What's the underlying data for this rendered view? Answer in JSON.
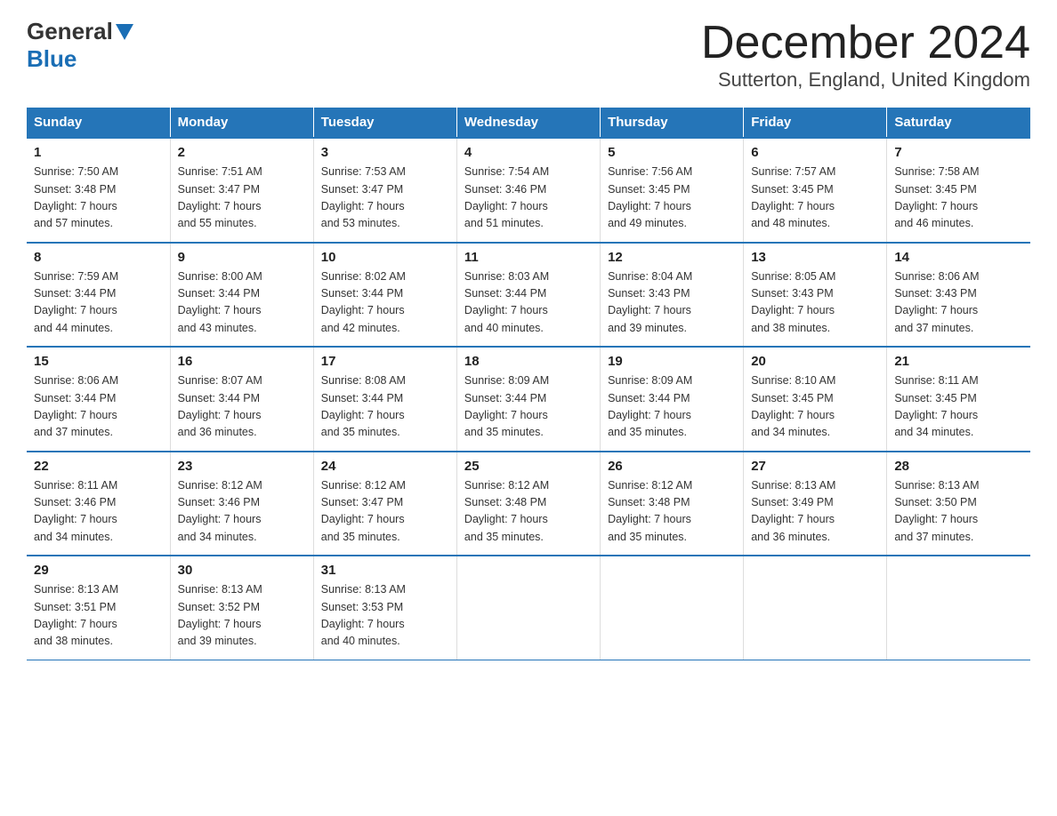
{
  "header": {
    "logo_general": "General",
    "logo_blue": "Blue",
    "month_title": "December 2024",
    "location": "Sutterton, England, United Kingdom"
  },
  "weekdays": [
    "Sunday",
    "Monday",
    "Tuesday",
    "Wednesday",
    "Thursday",
    "Friday",
    "Saturday"
  ],
  "weeks": [
    [
      {
        "day": "1",
        "sunrise": "7:50 AM",
        "sunset": "3:48 PM",
        "daylight": "7 hours and 57 minutes."
      },
      {
        "day": "2",
        "sunrise": "7:51 AM",
        "sunset": "3:47 PM",
        "daylight": "7 hours and 55 minutes."
      },
      {
        "day": "3",
        "sunrise": "7:53 AM",
        "sunset": "3:47 PM",
        "daylight": "7 hours and 53 minutes."
      },
      {
        "day": "4",
        "sunrise": "7:54 AM",
        "sunset": "3:46 PM",
        "daylight": "7 hours and 51 minutes."
      },
      {
        "day": "5",
        "sunrise": "7:56 AM",
        "sunset": "3:45 PM",
        "daylight": "7 hours and 49 minutes."
      },
      {
        "day": "6",
        "sunrise": "7:57 AM",
        "sunset": "3:45 PM",
        "daylight": "7 hours and 48 minutes."
      },
      {
        "day": "7",
        "sunrise": "7:58 AM",
        "sunset": "3:45 PM",
        "daylight": "7 hours and 46 minutes."
      }
    ],
    [
      {
        "day": "8",
        "sunrise": "7:59 AM",
        "sunset": "3:44 PM",
        "daylight": "7 hours and 44 minutes."
      },
      {
        "day": "9",
        "sunrise": "8:00 AM",
        "sunset": "3:44 PM",
        "daylight": "7 hours and 43 minutes."
      },
      {
        "day": "10",
        "sunrise": "8:02 AM",
        "sunset": "3:44 PM",
        "daylight": "7 hours and 42 minutes."
      },
      {
        "day": "11",
        "sunrise": "8:03 AM",
        "sunset": "3:44 PM",
        "daylight": "7 hours and 40 minutes."
      },
      {
        "day": "12",
        "sunrise": "8:04 AM",
        "sunset": "3:43 PM",
        "daylight": "7 hours and 39 minutes."
      },
      {
        "day": "13",
        "sunrise": "8:05 AM",
        "sunset": "3:43 PM",
        "daylight": "7 hours and 38 minutes."
      },
      {
        "day": "14",
        "sunrise": "8:06 AM",
        "sunset": "3:43 PM",
        "daylight": "7 hours and 37 minutes."
      }
    ],
    [
      {
        "day": "15",
        "sunrise": "8:06 AM",
        "sunset": "3:44 PM",
        "daylight": "7 hours and 37 minutes."
      },
      {
        "day": "16",
        "sunrise": "8:07 AM",
        "sunset": "3:44 PM",
        "daylight": "7 hours and 36 minutes."
      },
      {
        "day": "17",
        "sunrise": "8:08 AM",
        "sunset": "3:44 PM",
        "daylight": "7 hours and 35 minutes."
      },
      {
        "day": "18",
        "sunrise": "8:09 AM",
        "sunset": "3:44 PM",
        "daylight": "7 hours and 35 minutes."
      },
      {
        "day": "19",
        "sunrise": "8:09 AM",
        "sunset": "3:44 PM",
        "daylight": "7 hours and 35 minutes."
      },
      {
        "day": "20",
        "sunrise": "8:10 AM",
        "sunset": "3:45 PM",
        "daylight": "7 hours and 34 minutes."
      },
      {
        "day": "21",
        "sunrise": "8:11 AM",
        "sunset": "3:45 PM",
        "daylight": "7 hours and 34 minutes."
      }
    ],
    [
      {
        "day": "22",
        "sunrise": "8:11 AM",
        "sunset": "3:46 PM",
        "daylight": "7 hours and 34 minutes."
      },
      {
        "day": "23",
        "sunrise": "8:12 AM",
        "sunset": "3:46 PM",
        "daylight": "7 hours and 34 minutes."
      },
      {
        "day": "24",
        "sunrise": "8:12 AM",
        "sunset": "3:47 PM",
        "daylight": "7 hours and 35 minutes."
      },
      {
        "day": "25",
        "sunrise": "8:12 AM",
        "sunset": "3:48 PM",
        "daylight": "7 hours and 35 minutes."
      },
      {
        "day": "26",
        "sunrise": "8:12 AM",
        "sunset": "3:48 PM",
        "daylight": "7 hours and 35 minutes."
      },
      {
        "day": "27",
        "sunrise": "8:13 AM",
        "sunset": "3:49 PM",
        "daylight": "7 hours and 36 minutes."
      },
      {
        "day": "28",
        "sunrise": "8:13 AM",
        "sunset": "3:50 PM",
        "daylight": "7 hours and 37 minutes."
      }
    ],
    [
      {
        "day": "29",
        "sunrise": "8:13 AM",
        "sunset": "3:51 PM",
        "daylight": "7 hours and 38 minutes."
      },
      {
        "day": "30",
        "sunrise": "8:13 AM",
        "sunset": "3:52 PM",
        "daylight": "7 hours and 39 minutes."
      },
      {
        "day": "31",
        "sunrise": "8:13 AM",
        "sunset": "3:53 PM",
        "daylight": "7 hours and 40 minutes."
      },
      null,
      null,
      null,
      null
    ]
  ],
  "labels": {
    "sunrise": "Sunrise:",
    "sunset": "Sunset:",
    "daylight": "Daylight:"
  }
}
